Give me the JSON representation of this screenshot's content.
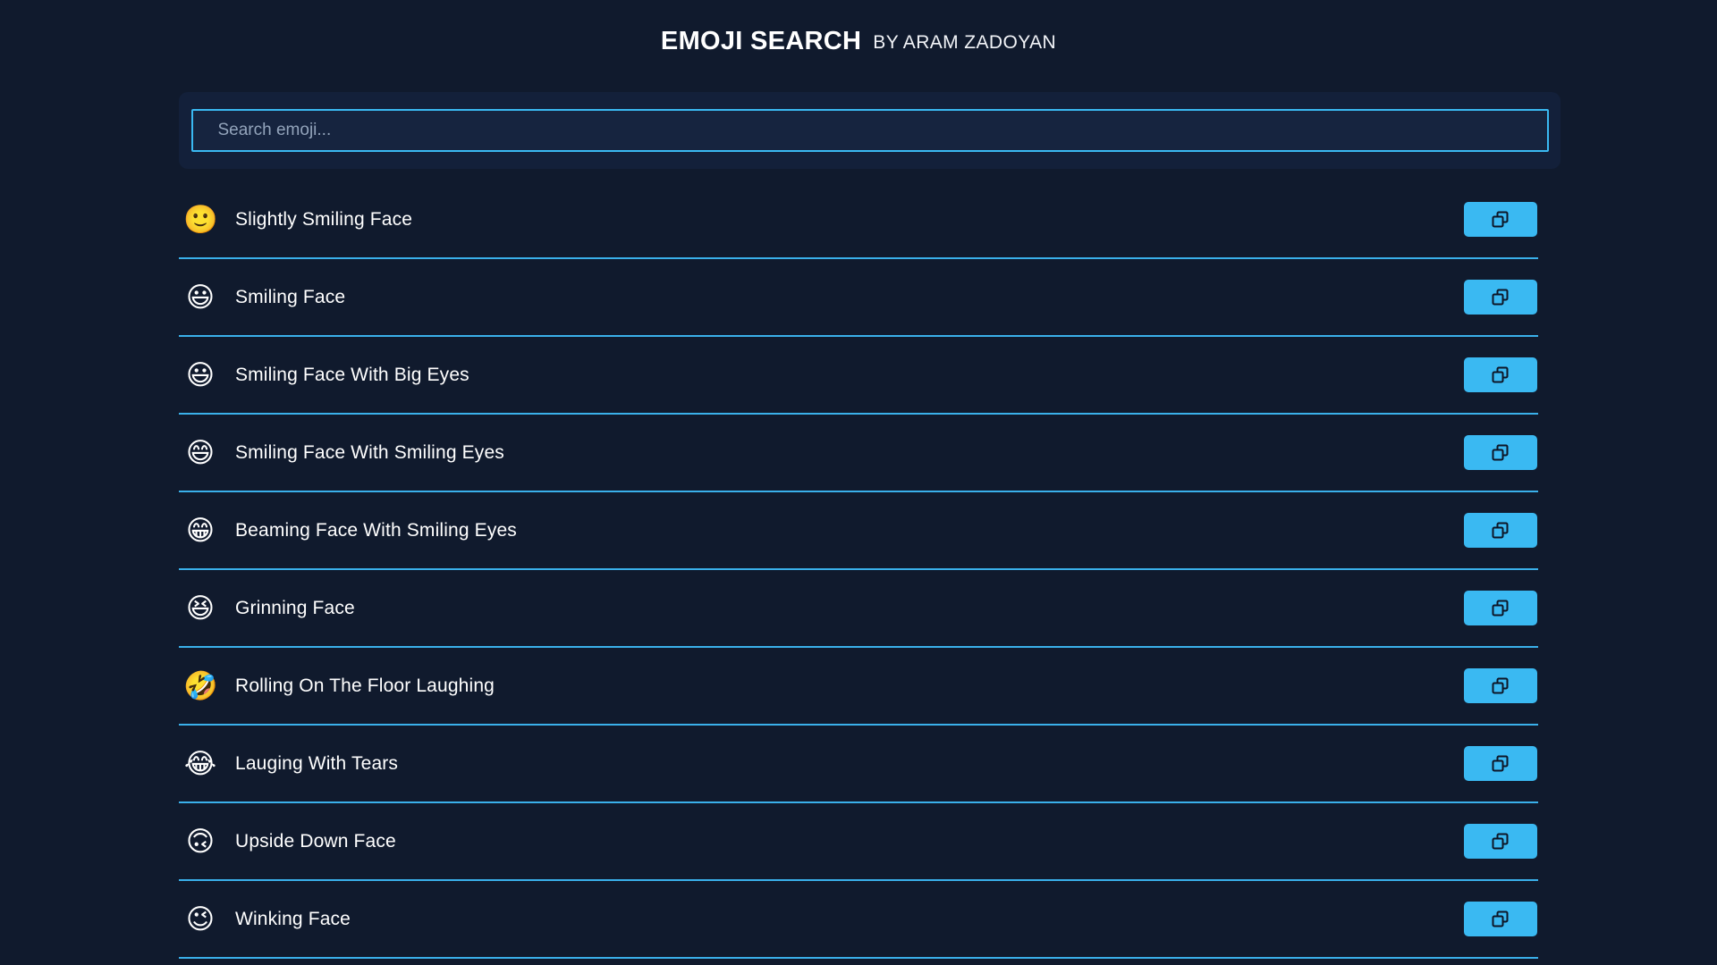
{
  "header": {
    "title": "EMOJI SEARCH",
    "subtitle": "BY ARAM ZADOYAN"
  },
  "search": {
    "placeholder": "Search emoji...",
    "value": ""
  },
  "colors": {
    "page_background": "#101a2d",
    "card_background": "#13203a",
    "accent": "#3ab9f2",
    "divider": "#3ab0ea",
    "text": "#ffffff",
    "placeholder_text": "#93a4bb"
  },
  "list": {
    "copy_button_label": "",
    "copy_icon": "copy-icon",
    "items": [
      {
        "emoji": "🙂",
        "name": "Slightly Smiling Face"
      },
      {
        "emoji": "😃",
        "name": "Smiling Face"
      },
      {
        "emoji": "😃",
        "name": "Smiling Face With Big Eyes"
      },
      {
        "emoji": "😄",
        "name": "Smiling Face With Smiling Eyes"
      },
      {
        "emoji": "😁",
        "name": "Beaming Face With Smiling Eyes"
      },
      {
        "emoji": "😆",
        "name": "Grinning Face"
      },
      {
        "emoji": "🤣",
        "name": "Rolling On The Floor Laughing"
      },
      {
        "emoji": "😂",
        "name": "Lauging With Tears"
      },
      {
        "emoji": "🙃",
        "name": "Upside Down Face"
      },
      {
        "emoji": "😉",
        "name": "Winking Face"
      }
    ]
  }
}
